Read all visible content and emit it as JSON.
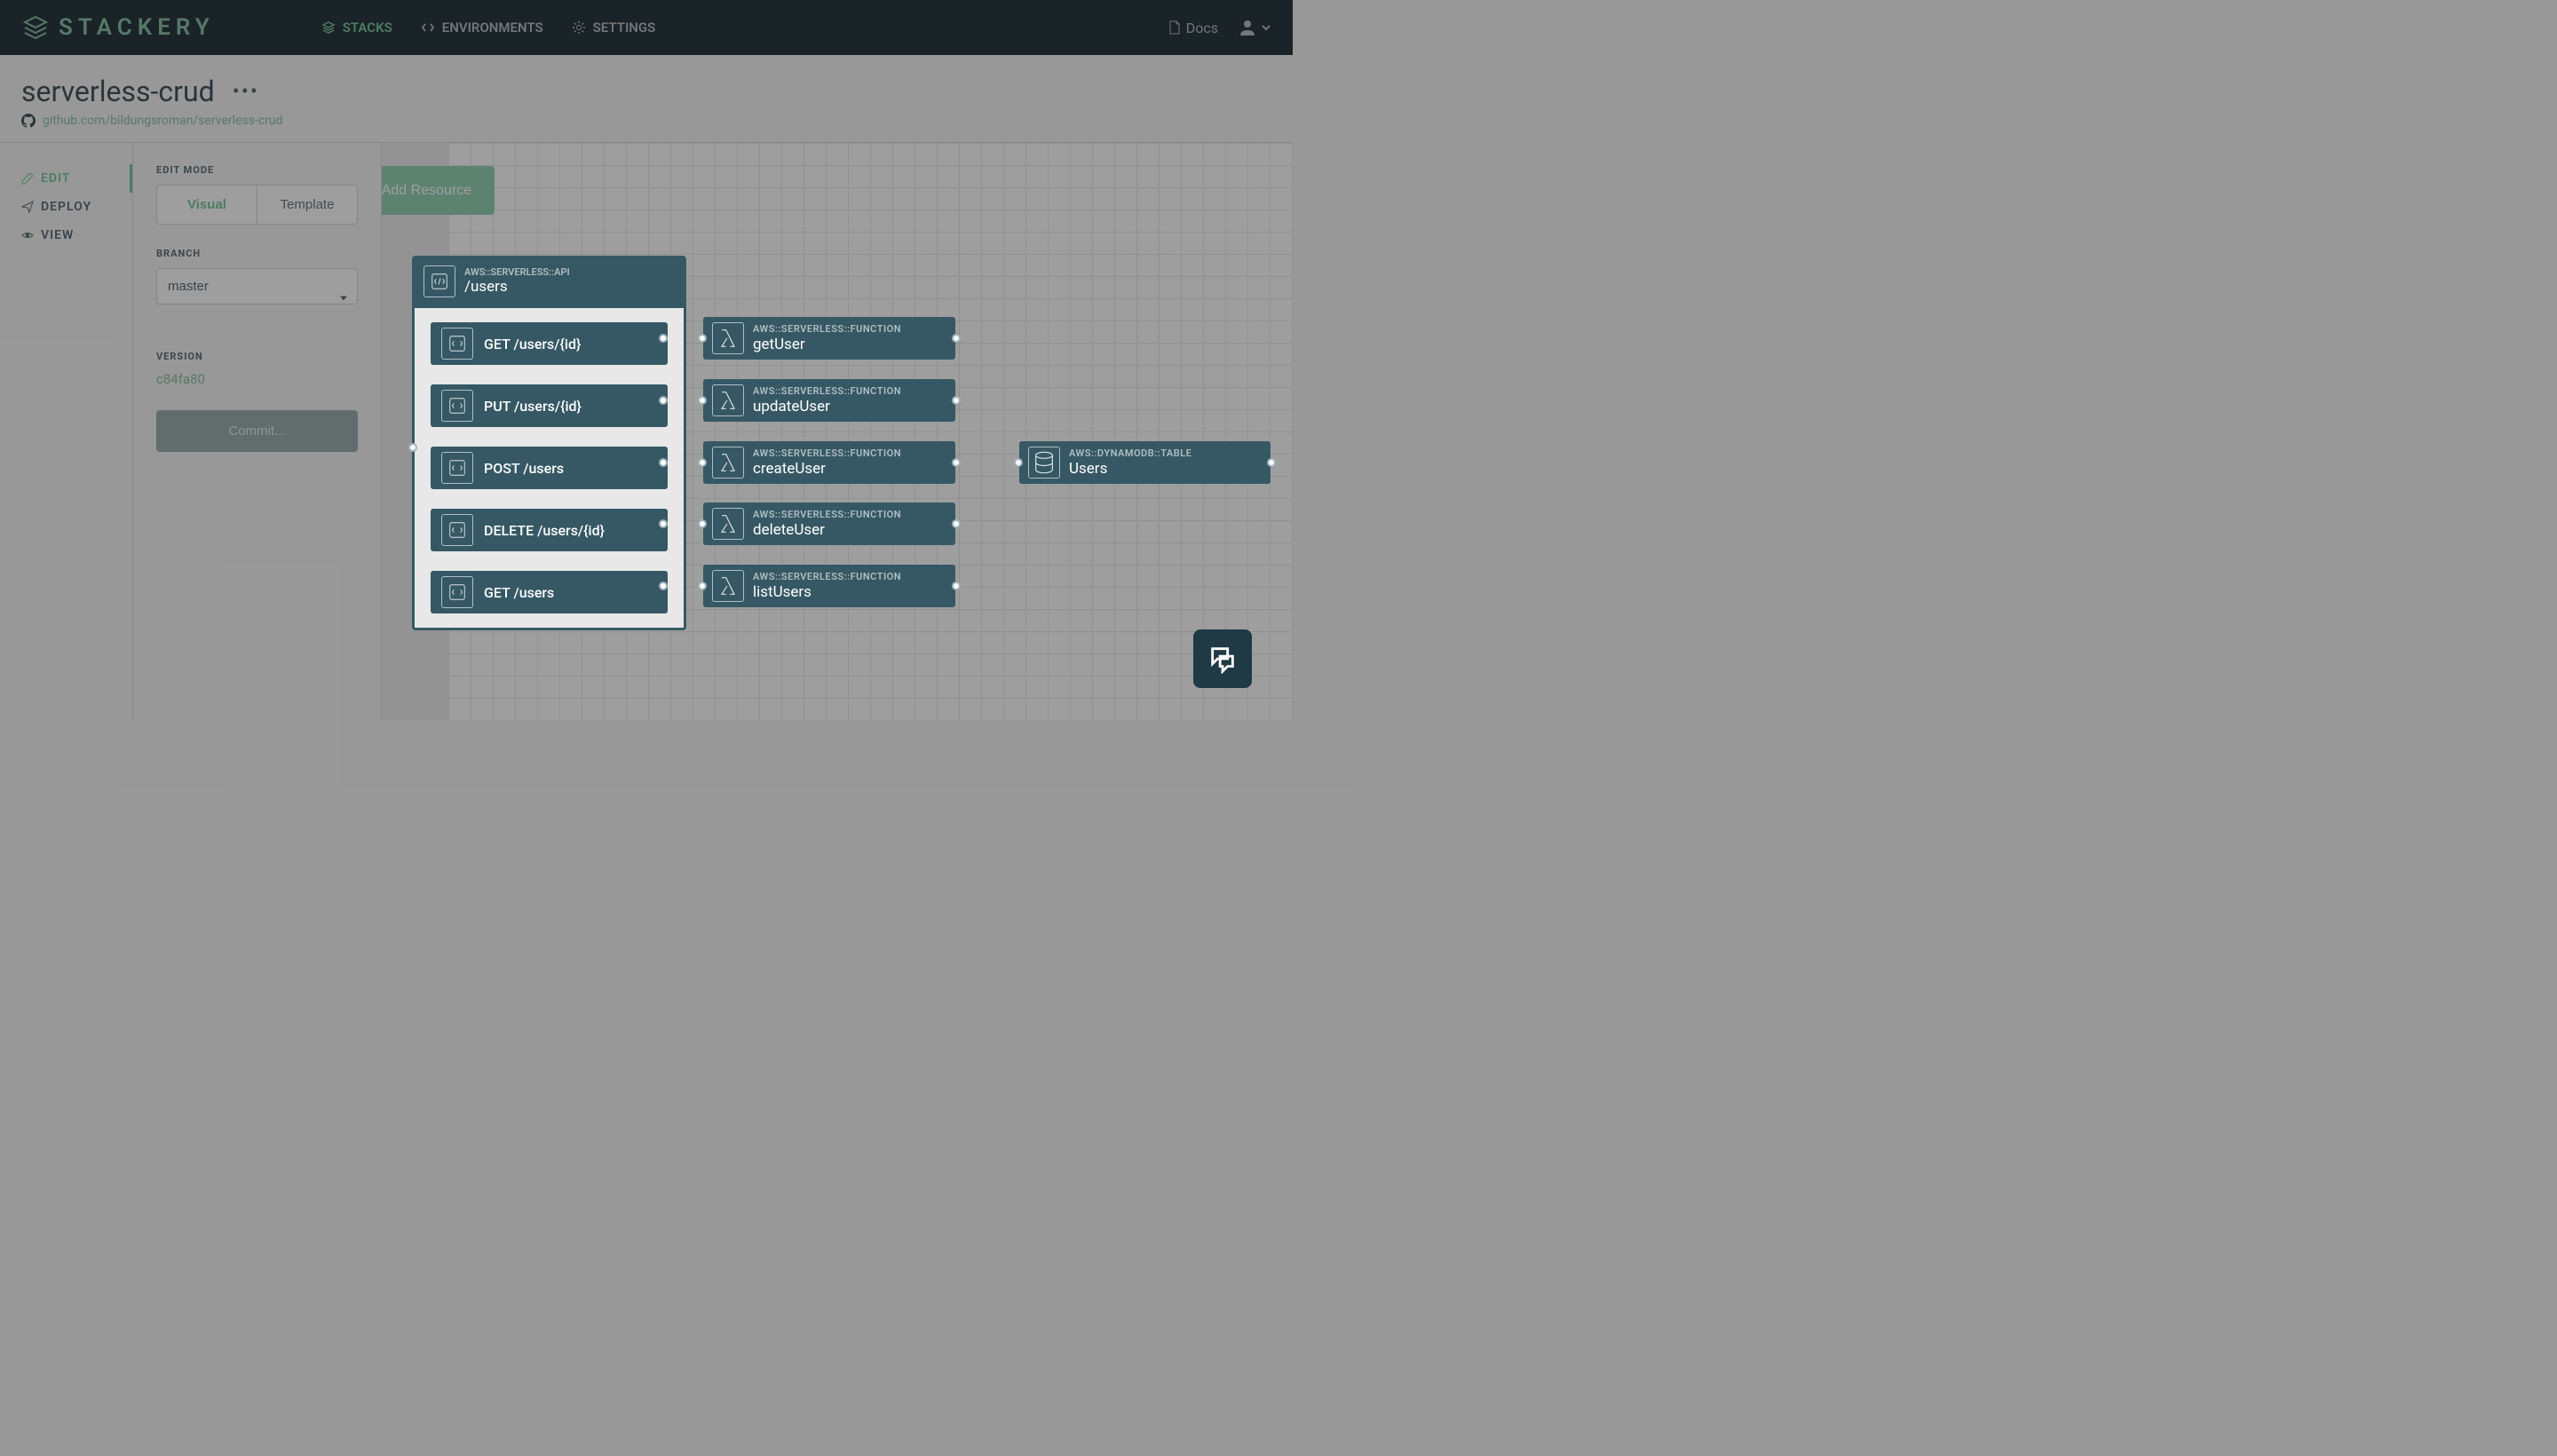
{
  "brand": "STACKERY",
  "topnav": {
    "stacks": "STACKS",
    "environments": "ENVIRONMENTS",
    "settings": "SETTINGS"
  },
  "topright": {
    "docs": "Docs"
  },
  "header": {
    "title": "serverless-crud",
    "repo": "github.com/bildungsroman/serverless-crud"
  },
  "left_tabs": {
    "edit": "EDIT",
    "deploy": "DEPLOY",
    "view": "VIEW"
  },
  "panel": {
    "edit_mode_label": "EDIT MODE",
    "visual": "Visual",
    "template": "Template",
    "branch_label": "BRANCH",
    "branch_value": "master",
    "version_label": "VERSION",
    "version_value": "c84fa80",
    "commit": "Commit..."
  },
  "add_resource": "Add Resource",
  "api": {
    "type": "AWS::SERVERLESS::API",
    "name": "/users",
    "routes": [
      {
        "label": "GET /users/{id}"
      },
      {
        "label": "PUT /users/{id}"
      },
      {
        "label": "POST /users"
      },
      {
        "label": "DELETE /users/{id}"
      },
      {
        "label": "GET /users"
      }
    ]
  },
  "functions": [
    {
      "type": "AWS::SERVERLESS::FUNCTION",
      "name": "getUser"
    },
    {
      "type": "AWS::SERVERLESS::FUNCTION",
      "name": "updateUser"
    },
    {
      "type": "AWS::SERVERLESS::FUNCTION",
      "name": "createUser"
    },
    {
      "type": "AWS::SERVERLESS::FUNCTION",
      "name": "deleteUser"
    },
    {
      "type": "AWS::SERVERLESS::FUNCTION",
      "name": "listUsers"
    }
  ],
  "table": {
    "type": "AWS::DYNAMODB::TABLE",
    "name": "Users"
  }
}
